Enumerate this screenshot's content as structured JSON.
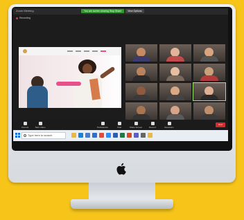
{
  "window": {
    "title": "Zoom Meeting",
    "share_status": "You are screen sharing   Stop Share",
    "view_options": "View Options",
    "recording": "Recording"
  },
  "slide": {
    "cta_label": ""
  },
  "participants": [
    {
      "name": "",
      "active": false,
      "skin": "#c68a64",
      "shirt": "#3c3c6a"
    },
    {
      "name": "",
      "active": false,
      "skin": "#e2b49a",
      "shirt": "#c14b4b"
    },
    {
      "name": "",
      "active": false,
      "skin": "#d8a57f",
      "shirt": "#555"
    },
    {
      "name": "",
      "active": false,
      "skin": "#b9835f",
      "shirt": "#2c2c2c"
    },
    {
      "name": "",
      "active": false,
      "skin": "#e6bfa3",
      "shirt": "#7a6a5e"
    },
    {
      "name": "",
      "active": false,
      "skin": "#caa078",
      "shirt": "#b33a3a"
    },
    {
      "name": "",
      "active": false,
      "skin": "#8e5b3f",
      "shirt": "#3a3a3a"
    },
    {
      "name": "",
      "active": false,
      "skin": "#d9a985",
      "shirt": "#444"
    },
    {
      "name": "",
      "active": true,
      "skin": "#e0b095",
      "shirt": "#2a2a2a"
    },
    {
      "name": "",
      "active": false,
      "skin": "#a87552",
      "shirt": "#333"
    },
    {
      "name": "",
      "active": false,
      "skin": "#d6a488",
      "shirt": "#5a5a5a"
    },
    {
      "name": "",
      "active": false,
      "skin": "#c0906e",
      "shirt": "#3b3b3b"
    }
  ],
  "controls": [
    {
      "label": "Unmute",
      "icon": "microphone-icon"
    },
    {
      "label": "Start Video",
      "icon": "video-camera-icon"
    },
    {
      "label": "Participants",
      "icon": "participants-icon"
    },
    {
      "label": "Chat",
      "icon": "chat-icon"
    },
    {
      "label": "Share Screen",
      "icon": "share-screen-icon"
    },
    {
      "label": "Record",
      "icon": "record-icon"
    },
    {
      "label": "Reactions",
      "icon": "reactions-icon"
    }
  ],
  "end_label": "End",
  "taskbar": {
    "search_placeholder": "Type here to search",
    "time": "",
    "date": "",
    "apps": [
      "file-explorer-icon",
      "edge-icon",
      "store-icon",
      "mail-icon",
      "chrome-icon",
      "zoom-icon",
      "word-icon",
      "excel-icon",
      "powerpoint-icon",
      "teams-icon",
      "settings-icon",
      "folder-icon"
    ]
  },
  "colors": {
    "background": "#f7c51a",
    "zoom_green": "#2e9a2e",
    "end_red": "#d62b2b",
    "slide_accent": "#e7508a"
  }
}
